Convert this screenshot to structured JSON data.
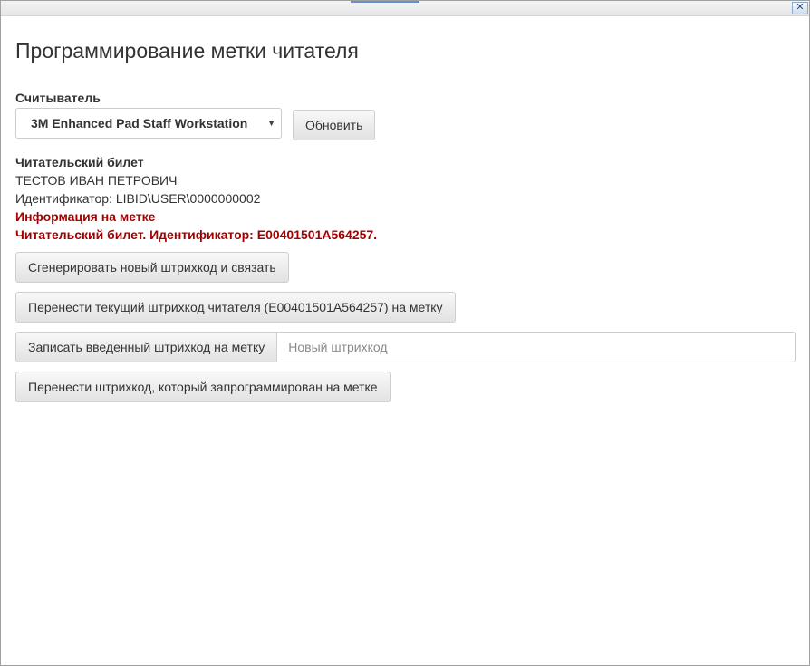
{
  "window": {
    "close_glyph": "✕"
  },
  "dialog": {
    "title": "Программирование метки читателя",
    "reader_label": "Считыватель",
    "reader_selected": "3M Enhanced Pad Staff Workstation",
    "refresh_label": "Обновить"
  },
  "reader_card": {
    "heading": "Читательский билет",
    "name": "ТЕСТОВ ИВАН ПЕТРОВИЧ",
    "identifier": "Идентификатор: LIBID\\USER\\0000000002",
    "tag_info_heading": "Информация на метке",
    "tag_info_text": "Читательский билет. Идентификатор: E00401501A564257."
  },
  "actions": {
    "generate_label": "Сгенерировать новый штрихкод и связать",
    "transfer_current_label": "Перенести текущий штрихкод читателя (E00401501A564257) на метку",
    "write_entered_label": "Записать введенный штрихкод на метку",
    "new_barcode_placeholder": "Новый штрихкод",
    "new_barcode_value": "",
    "transfer_tag_label": "Перенести штрихкод, который запрограммирован на метке"
  },
  "colors": {
    "accent_red": "#a30000",
    "text": "#333333"
  }
}
